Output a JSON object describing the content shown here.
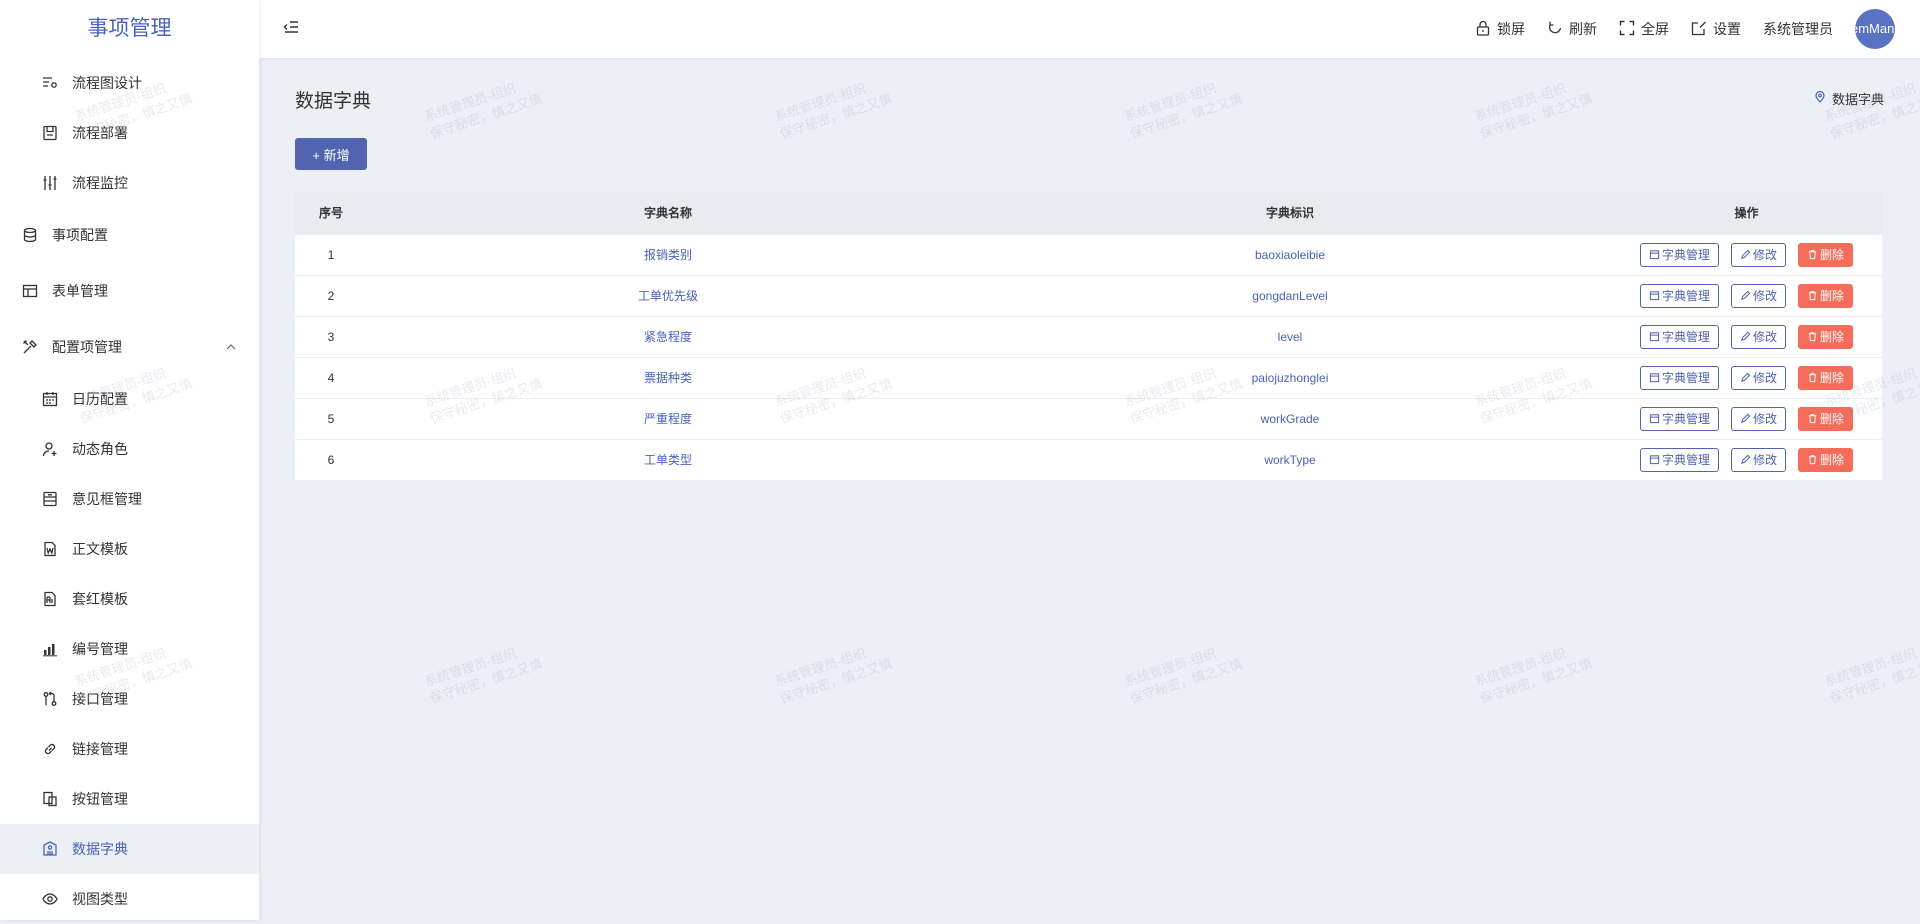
{
  "sidebar": {
    "brand": "事项管理",
    "items": [
      {
        "label": "流程图设计",
        "icon": "flow-design-icon"
      },
      {
        "label": "流程部署",
        "icon": "deploy-icon"
      },
      {
        "label": "流程监控",
        "icon": "monitor-icon"
      },
      {
        "label": "事项配置",
        "icon": "database-icon"
      },
      {
        "label": "表单管理",
        "icon": "table-icon"
      },
      {
        "label": "配置项管理",
        "icon": "tools-icon",
        "expanded": true
      },
      {
        "label": "日历配置",
        "icon": "calendar-icon"
      },
      {
        "label": "动态角色",
        "icon": "user-add-icon"
      },
      {
        "label": "意见框管理",
        "icon": "form-box-icon"
      },
      {
        "label": "正文模板",
        "icon": "word-doc-icon"
      },
      {
        "label": "套红模板",
        "icon": "red-template-icon"
      },
      {
        "label": "编号管理",
        "icon": "bar-chart-icon"
      },
      {
        "label": "接口管理",
        "icon": "interface-icon"
      },
      {
        "label": "链接管理",
        "icon": "link-icon"
      },
      {
        "label": "按钮管理",
        "icon": "copy-icon"
      },
      {
        "label": "数据字典",
        "icon": "dictionary-icon",
        "active": true
      },
      {
        "label": "视图类型",
        "icon": "eye-icon"
      }
    ]
  },
  "header": {
    "lock": "锁屏",
    "refresh": "刷新",
    "fullscreen": "全屏",
    "settings": "设置",
    "user": "系统管理员",
    "avatar_text": "emMan"
  },
  "page": {
    "title": "数据字典",
    "breadcrumb": "数据字典",
    "add_button": "+ 新增"
  },
  "table": {
    "columns": [
      "序号",
      "字典名称",
      "字典标识",
      "操作"
    ],
    "rows": [
      {
        "no": "1",
        "name": "报销类别",
        "id": "baoxiaoleibie"
      },
      {
        "no": "2",
        "name": "工单优先级",
        "id": "gongdanLevel"
      },
      {
        "no": "3",
        "name": "紧急程度",
        "id": "level"
      },
      {
        "no": "4",
        "name": "票据种类",
        "id": "paiojuzhonglei"
      },
      {
        "no": "5",
        "name": "严重程度",
        "id": "workGrade"
      },
      {
        "no": "6",
        "name": "工单类型",
        "id": "workType"
      }
    ],
    "actions": {
      "manage": "字典管理",
      "edit": "修改",
      "delete": "删除"
    }
  },
  "watermark": {
    "line1": "系统管理员-组织",
    "line2": "保守秘密，慎之又慎"
  },
  "colors": {
    "accent": "#5064b0",
    "danger": "#f56c5a",
    "background": "#eceff6"
  }
}
